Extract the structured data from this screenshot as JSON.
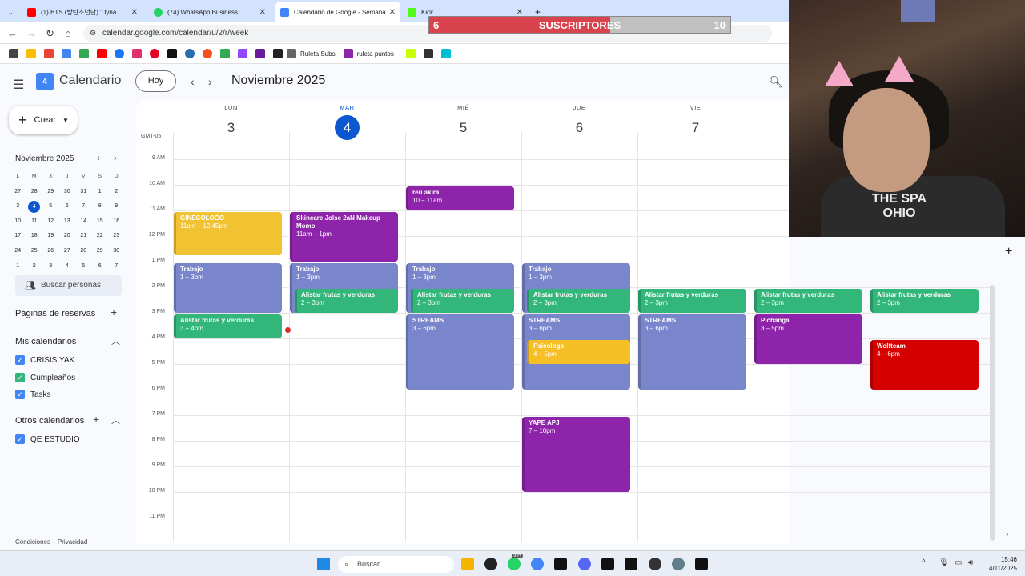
{
  "browser": {
    "tabs": [
      {
        "title": "(1) BTS (방탄소년단) 'Dyna",
        "favicon_color": "#ff0000"
      },
      {
        "title": "(74) WhatsApp Business",
        "favicon_color": "#25d366"
      },
      {
        "title": "Calendario de Google - Semana",
        "favicon_color": "#4285f4"
      },
      {
        "title": "Kick",
        "favicon_color": "#53fc18"
      }
    ],
    "url": "calendar.google.com/calendar/u/2/r/week",
    "bookmarks": [
      "Ruleta Subs",
      "ruleta puntos"
    ]
  },
  "overlay": {
    "label": "SUSCRIPTORES",
    "current": "6",
    "goal": "10",
    "progress": 0.6
  },
  "calendar": {
    "app_name": "Calendario",
    "logo_day": "4",
    "today_button": "Hoy",
    "month_title": "Noviembre 2025",
    "timezone": "GMT-05",
    "days": [
      {
        "name": "LUN",
        "num": "3"
      },
      {
        "name": "MAR",
        "num": "4",
        "today": true
      },
      {
        "name": "MIÉ",
        "num": "5"
      },
      {
        "name": "JUE",
        "num": "6"
      },
      {
        "name": "VIE",
        "num": "7"
      }
    ],
    "hours": [
      "9 AM",
      "10 AM",
      "11 AM",
      "12 PM",
      "1 PM",
      "2 PM",
      "3 PM",
      "4 PM",
      "5 PM",
      "6 PM",
      "7 PM",
      "8 PM",
      "9 PM",
      "10 PM",
      "11 PM"
    ],
    "events": [
      {
        "title": "GINECOLOGO",
        "time": "11am – 12:45pm",
        "color": "yellow"
      },
      {
        "title": "Skincare Jolse 2aN Makeup Momo",
        "time": "11am – 1pm",
        "color": "purple"
      },
      {
        "title": "reu akira",
        "time": "10 – 11am",
        "color": "purple"
      },
      {
        "title": "Trabajo",
        "time": "1 – 3pm",
        "color": "lav"
      },
      {
        "title": "Trabajo",
        "time": "1 – 3pm",
        "color": "lav"
      },
      {
        "title": "Trabajo",
        "time": "1 – 3pm",
        "color": "lav"
      },
      {
        "title": "Trabajo",
        "time": "1 – 3pm",
        "color": "lav"
      },
      {
        "title": "Alistar frutas y verduras",
        "time": "2 – 3pm",
        "color": "green"
      },
      {
        "title": "Alistar frutas y verduras",
        "time": "2 – 3pm",
        "color": "green"
      },
      {
        "title": "Alistar frutas y verduras",
        "time": "2 – 3pm",
        "color": "green"
      },
      {
        "title": "Alistar frutas y verduras",
        "time": "2 – 3pm",
        "color": "green"
      },
      {
        "title": "Alistar frutas y verduras",
        "time": "2 – 3pm",
        "color": "green"
      },
      {
        "title": "Alistar frutas y verduras",
        "time": "2 – 3pm",
        "color": "green"
      },
      {
        "title": "Alistar frutas y verduras",
        "time": "3 – 4pm",
        "color": "green"
      },
      {
        "title": "STREAMS",
        "time": "3 – 6pm",
        "color": "lav"
      },
      {
        "title": "STREAMS",
        "time": "3 – 6pm",
        "color": "lav"
      },
      {
        "title": "STREAMS",
        "time": "3 – 6pm",
        "color": "lav"
      },
      {
        "title": "Psicologo",
        "time": "4 – 5pm",
        "color": "gold"
      },
      {
        "title": "Pichanga",
        "time": "3 – 5pm",
        "color": "purple"
      },
      {
        "title": "Wolfteam",
        "time": "4 – 6pm",
        "color": "red"
      },
      {
        "title": "YAPE APJ",
        "time": "7 – 10pm",
        "color": "purple"
      }
    ]
  },
  "sidebar": {
    "create_label": "Crear",
    "mini_title": "Noviembre 2025",
    "mini_weekdays": [
      "L",
      "M",
      "X",
      "J",
      "V",
      "S",
      "D"
    ],
    "mini_weeks": [
      [
        "27",
        "28",
        "29",
        "30",
        "31",
        "1",
        "2"
      ],
      [
        "3",
        "4",
        "5",
        "6",
        "7",
        "8",
        "9"
      ],
      [
        "10",
        "11",
        "12",
        "13",
        "14",
        "15",
        "16"
      ],
      [
        "17",
        "18",
        "19",
        "20",
        "21",
        "22",
        "23"
      ],
      [
        "24",
        "25",
        "26",
        "27",
        "28",
        "29",
        "30"
      ],
      [
        "1",
        "2",
        "3",
        "4",
        "5",
        "6",
        "7"
      ]
    ],
    "find_people": "Buscar personas",
    "booking_pages": "Páginas de reservas",
    "my_calendars_title": "Mis calendarios",
    "my_calendars": [
      "CRISIS YAK",
      "Cumpleaños",
      "Tasks"
    ],
    "other_calendars_title": "Otros calendarios",
    "other_calendars": [
      "QE ESTUDIO"
    ],
    "footer": "Condiciones – Privacidad"
  },
  "webcam": {
    "shirt_text": "THE SPA OHIO"
  },
  "taskbar": {
    "search_placeholder": "Buscar",
    "badge": "99+",
    "time": "15:46",
    "date": "4/11/2025"
  }
}
